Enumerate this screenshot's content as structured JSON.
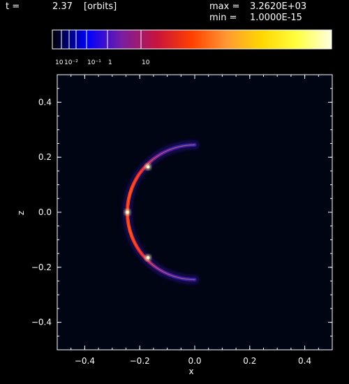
{
  "header": {
    "time_label": "t =",
    "time_value": "2.37",
    "time_unit": "[orbits]",
    "max_label": "max =",
    "max_value": "3.2620E+03",
    "min_label": "min =",
    "min_value": "1.0000E-15"
  },
  "colorbar": {
    "labels": [
      "10",
      "10⁻²",
      "10⁻¹",
      "1",
      "10"
    ],
    "stops": [
      "#000000",
      "#0000ff",
      "#7a1ea0",
      "#c8143c",
      "#ff4000",
      "#ff9933",
      "#ffd700",
      "#ffff40",
      "#ffffe0"
    ]
  },
  "chart_data": {
    "type": "heatmap",
    "title": "",
    "xlabel": "x",
    "ylabel": "z",
    "xlim": [
      -0.5,
      0.5
    ],
    "ylim": [
      -0.5,
      0.5
    ],
    "xticks": [
      -0.4,
      -0.2,
      0.0,
      0.2,
      0.4
    ],
    "yticks": [
      -0.4,
      -0.2,
      0.0,
      0.2,
      0.4
    ],
    "xtick_labels": [
      "−0.4",
      "−0.2",
      "0.0",
      "0.2",
      "0.4"
    ],
    "ytick_labels": [
      "−0.4",
      "−0.2",
      "0.0",
      "0.2",
      "0.4"
    ],
    "background_color": "#000514",
    "features": [
      {
        "name": "shell",
        "shape": "half-ellipse arc",
        "center_x": 0.0,
        "center_z": 0.0,
        "radius_x": 0.245,
        "radius_z": 0.245,
        "from_angle_deg": 90,
        "to_angle_deg": 270
      },
      {
        "name": "hot-spot-upper",
        "x": -0.17,
        "z": 0.165
      },
      {
        "name": "hot-spot-lower",
        "x": -0.17,
        "z": -0.165
      },
      {
        "name": "hot-spot-left",
        "x": -0.245,
        "z": 0.0
      }
    ]
  }
}
